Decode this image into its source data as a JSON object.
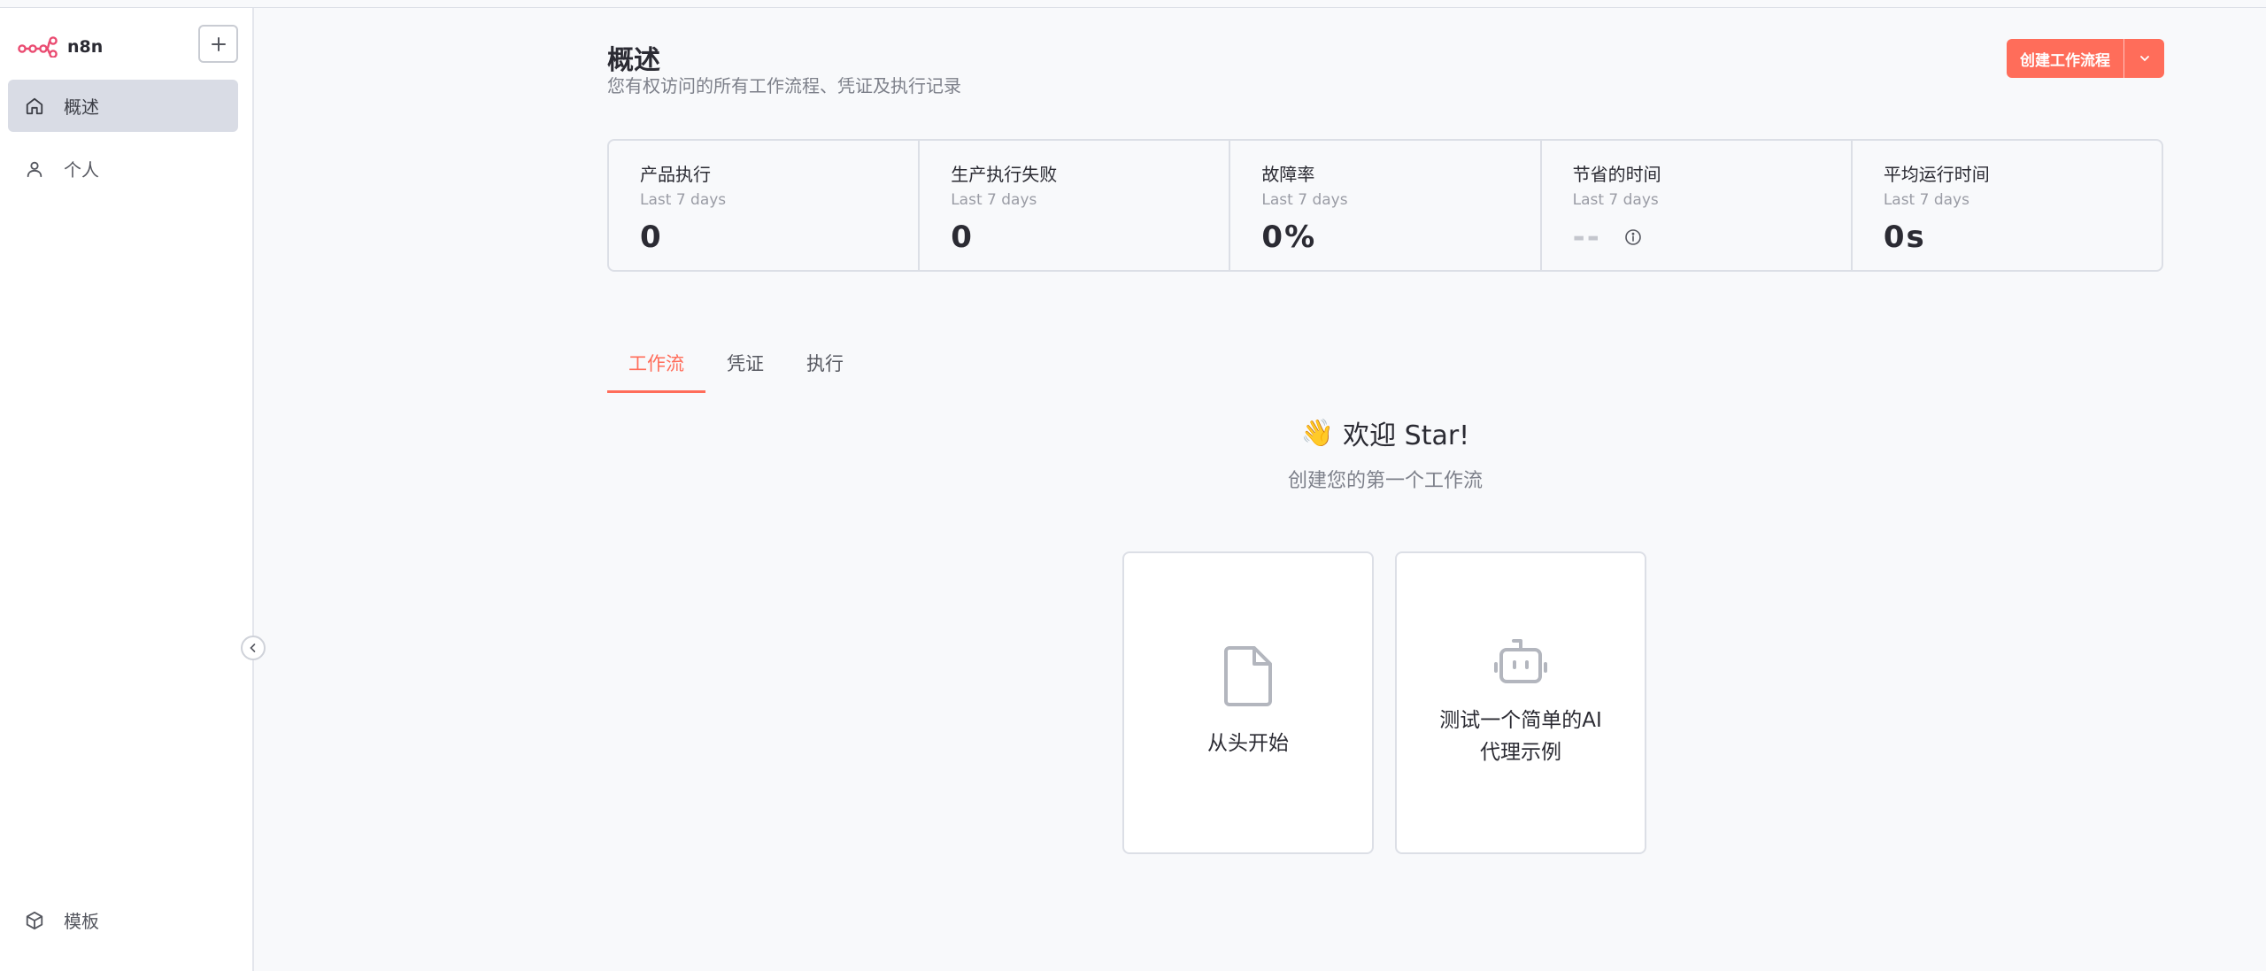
{
  "sidebar": {
    "brand": "n8n",
    "add_label": "+",
    "nav": [
      {
        "label": "概述",
        "icon": "home-icon",
        "active": true
      },
      {
        "label": "个人",
        "icon": "user-icon",
        "active": false
      }
    ],
    "bottom": [
      {
        "label": "模板",
        "icon": "package-icon"
      }
    ]
  },
  "header": {
    "title": "概述",
    "subtitle": "您有权访问的所有工作流程、凭证及执行记录",
    "create_button": "创建工作流程"
  },
  "stats": [
    {
      "title": "产品执行",
      "period": "Last 7 days",
      "value": "0"
    },
    {
      "title": "生产执行失败",
      "period": "Last 7 days",
      "value": "0"
    },
    {
      "title": "故障率",
      "period": "Last 7 days",
      "value": "0%"
    },
    {
      "title": "节省的时间",
      "period": "Last 7 days",
      "value": "--"
    },
    {
      "title": "平均运行时间",
      "period": "Last 7 days",
      "value": "0s"
    }
  ],
  "tabs": [
    {
      "label": "工作流",
      "active": true
    },
    {
      "label": "凭证",
      "active": false
    },
    {
      "label": "执行",
      "active": false
    }
  ],
  "empty_state": {
    "emoji": "👋",
    "welcome": "欢迎 Star!",
    "subtitle": "创建您的第一个工作流",
    "cards": [
      {
        "label": "从头开始",
        "icon": "file-icon"
      },
      {
        "label": "测试一个简单的AI代理示例",
        "line1": "测试一个简单的AI",
        "line2": "代理示例",
        "icon": "robot-icon"
      }
    ]
  },
  "colors": {
    "accent": "#ff6d5a",
    "sidebar_active": "#d9dce5",
    "background": "#f8f9fb"
  }
}
